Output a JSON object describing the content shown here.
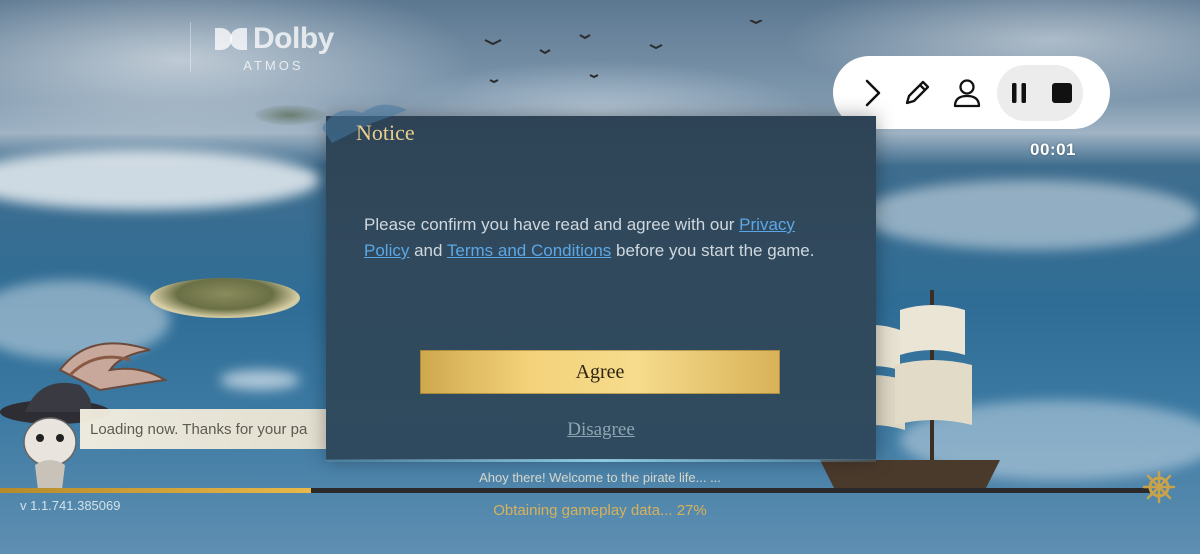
{
  "logo": {
    "brand": "Dolby",
    "subtitle": "ATMOS"
  },
  "recorder": {
    "timer": "00:01",
    "icons": [
      "chevron-right-icon",
      "pencil-icon",
      "person-icon",
      "pause-icon",
      "stop-icon"
    ]
  },
  "dialog": {
    "title": "Notice",
    "message_start": "Please confirm you have read and agree with our ",
    "privacy_link": "Privacy Policy",
    "message_and": " and ",
    "terms_link": "Terms and Conditions",
    "message_end": " before you start the game.",
    "agree_label": "Agree",
    "disagree_label": "Disagree"
  },
  "loading": {
    "banner_text": "Loading now. Thanks for your pa",
    "tip": "Ahoy there! Welcome to the pirate life... ...",
    "status": "Obtaining gameplay data... 27%",
    "progress": 0.27,
    "version": "v 1.1.741.385069"
  },
  "colors": {
    "accent_gold": "#e8cd8d",
    "link_blue": "#5ba7e6",
    "status_gold": "#d7b25b",
    "dialog_bg": "#31495c"
  }
}
